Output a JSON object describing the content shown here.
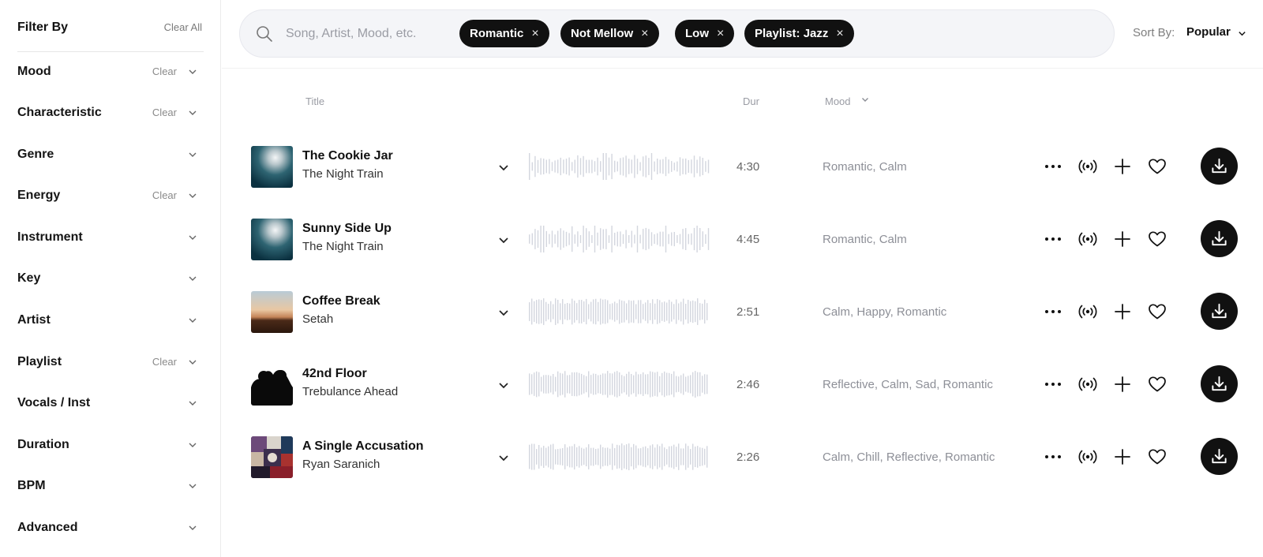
{
  "sidebar": {
    "title": "Filter By",
    "clear_all": "Clear All",
    "filters": [
      {
        "label": "Mood",
        "clear": "Clear"
      },
      {
        "label": "Characteristic",
        "clear": "Clear"
      },
      {
        "label": "Genre",
        "clear": null
      },
      {
        "label": "Energy",
        "clear": "Clear"
      },
      {
        "label": "Instrument",
        "clear": null
      },
      {
        "label": "Key",
        "clear": null
      },
      {
        "label": "Artist",
        "clear": null
      },
      {
        "label": "Playlist",
        "clear": "Clear"
      },
      {
        "label": "Vocals / Inst",
        "clear": null
      },
      {
        "label": "Duration",
        "clear": null
      },
      {
        "label": "BPM",
        "clear": null
      },
      {
        "label": "Advanced",
        "clear": null
      }
    ]
  },
  "search": {
    "placeholder": "Song, Artist, Mood, etc.",
    "value": "",
    "chips": [
      "Romantic",
      "Not Mellow",
      "Low",
      "Playlist: Jazz"
    ],
    "chip_remove_glyph": "×"
  },
  "sort": {
    "label": "Sort By:",
    "value": "Popular"
  },
  "table": {
    "headers": {
      "title": "Title",
      "duration": "Dur",
      "mood": "Mood"
    },
    "tracks": [
      {
        "title": "The Cookie Jar",
        "artist": "The Night Train",
        "duration": "4:30",
        "moods": "Romantic, Calm",
        "art": "night-sky"
      },
      {
        "title": "Sunny Side Up",
        "artist": "The Night Train",
        "duration": "4:45",
        "moods": "Romantic, Calm",
        "art": "night-sky"
      },
      {
        "title": "Coffee Break",
        "artist": "Setah",
        "duration": "2:51",
        "moods": "Calm, Happy, Romantic",
        "art": "sunset-field"
      },
      {
        "title": "42nd Floor",
        "artist": "Trebulance Ahead",
        "duration": "2:46",
        "moods": "Reflective, Calm, Sad, Romantic",
        "art": "silhouette"
      },
      {
        "title": "A Single Accusation",
        "artist": "Ryan Saranich",
        "duration": "2:26",
        "moods": "Calm, Chill, Reflective, Romantic",
        "art": "collage"
      }
    ]
  },
  "icons": {
    "search": "search-icon",
    "chevron": "chevron-down-icon",
    "more": "more-options-icon",
    "radio": "radio-broadcast-icon",
    "add": "plus-icon",
    "favorite": "heart-icon",
    "download": "download-icon"
  },
  "colors": {
    "accent": "#111111",
    "muted_text": "#8d8f97",
    "waveform": "#d3d6de",
    "search_bg": "#f4f5f8"
  }
}
